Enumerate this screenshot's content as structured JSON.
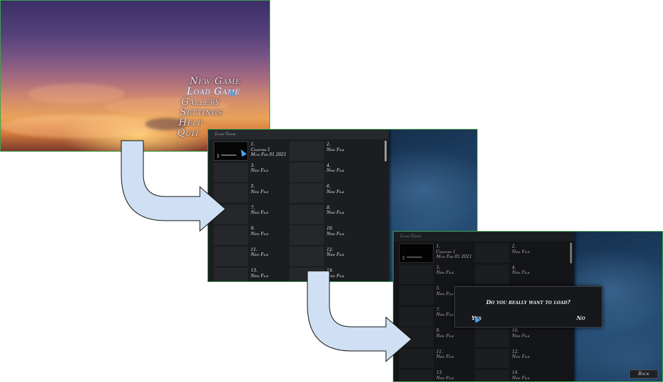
{
  "title_screen": {
    "menu": [
      "New Game",
      "Load Game",
      "Gallery",
      "Settings",
      "Help",
      "Quit"
    ],
    "selected_index": 1
  },
  "load_screen": {
    "header": "Load Game",
    "slots": [
      {
        "label": "1.",
        "line1": "Chapter 1",
        "line2": "Mon Feb 01 2021",
        "filled": true
      },
      {
        "label": "2.",
        "line1": "New File",
        "filled": false
      },
      {
        "label": "3.",
        "line1": "New File",
        "filled": false
      },
      {
        "label": "4.",
        "line1": "New File",
        "filled": false
      },
      {
        "label": "5.",
        "line1": "New File",
        "filled": false
      },
      {
        "label": "6.",
        "line1": "New File",
        "filled": false
      },
      {
        "label": "7.",
        "line1": "New File",
        "filled": false
      },
      {
        "label": "8.",
        "line1": "New File",
        "filled": false
      },
      {
        "label": "9.",
        "line1": "New File",
        "filled": false
      },
      {
        "label": "10.",
        "line1": "New File",
        "filled": false
      },
      {
        "label": "11.",
        "line1": "New File",
        "filled": false
      },
      {
        "label": "12.",
        "line1": "New File",
        "filled": false
      },
      {
        "label": "13.",
        "line1": "New File",
        "filled": false
      },
      {
        "label": "14.",
        "line1": "New File",
        "filled": false
      }
    ]
  },
  "confirm_screen": {
    "header": "Load Game",
    "question": "Do you really want to load?",
    "yes_label": "Yes",
    "no_label": "No",
    "back_label": "Back"
  },
  "colors": {
    "arrow_fill": "#cfe0f4",
    "arrow_stroke": "#111111",
    "frame_border": "#3fa24a",
    "cursor": "#4fa3e6"
  },
  "icons": [
    "pointer-cursor-icon",
    "flow-arrow-icon"
  ]
}
